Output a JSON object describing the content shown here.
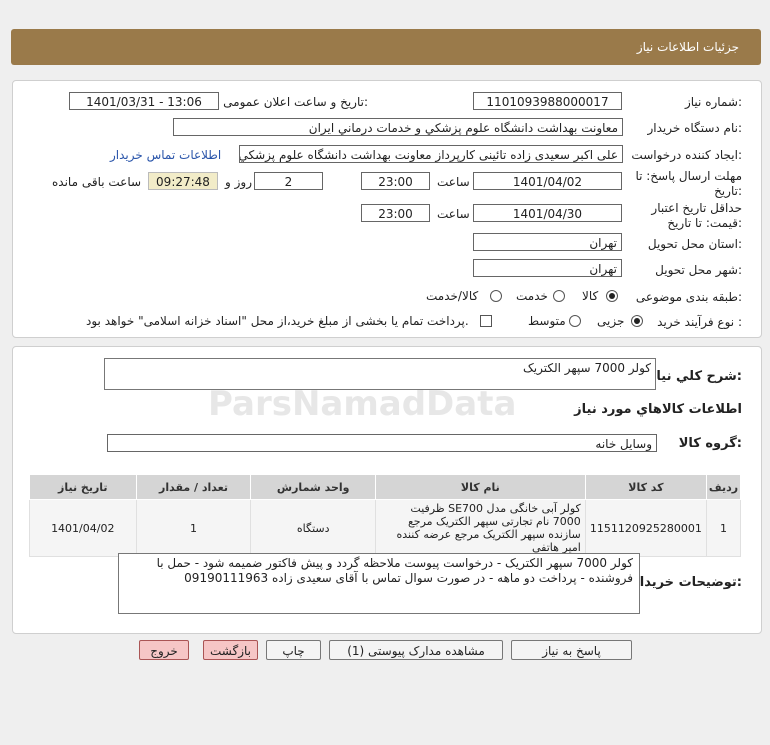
{
  "header": {
    "title": "جزئیات اطلاعات نیاز"
  },
  "form": {
    "need_number_label": "شماره نیاز:",
    "need_number": "1101093988000017",
    "announce_label": "تاریخ و ساعت اعلان عمومی:",
    "announce_value": "1401/03/31 - 13:06",
    "buyer_org_label": "نام دستگاه خریدار:",
    "buyer_org": "معاونت بهداشت دانشگاه علوم پزشکي و خدمات درماني ایران",
    "creator_label": "ایجاد کننده درخواست:",
    "creator": "علی اکبر سعیدی زاده تائینی کارپرداز معاونت بهداشت دانشگاه علوم پزشکي و",
    "contact_link": "اطلاعات تماس خریدار",
    "deadline_label_1": "مهلت ارسال پاسخ: تا",
    "deadline_label_2": "تاریخ:",
    "deadline_date": "1401/04/02",
    "time_label": "ساعت",
    "deadline_time": "23:00",
    "days_value": "2",
    "days_label": "روز و",
    "remaining_time": "09:27:48",
    "remaining_label": "ساعت باقی مانده",
    "validity_label_1": "حداقل تاریخ اعتبار",
    "validity_label_2": "قیمت: تا تاریخ:",
    "validity_date": "1401/04/30",
    "validity_time": "23:00",
    "province_label": "استان محل تحویل:",
    "province": "تهران",
    "city_label": "شهر محل تحویل:",
    "city": "تهران",
    "category_label": "طبقه بندی موضوعی:",
    "category_options": [
      "کالا",
      "خدمت",
      "کالا/خدمت"
    ],
    "process_label": "نوع فرآیند خرید :",
    "process_options": [
      "جزیی",
      "متوسط"
    ],
    "payment_note": "پرداخت تمام یا بخشی از مبلغ خرید،از محل \"اسناد خزانه اسلامی\" خواهد بود."
  },
  "details": {
    "need_desc_label": "شرح کلي نياز:",
    "need_desc": "کولر 7000 سپهر الکتریک",
    "items_title": "اطلاعات کالاهاي مورد نياز",
    "group_label": "گروه کالا:",
    "group_value": "وسایل خانه",
    "table_headers": [
      "ردیف",
      "کد کالا",
      "نام کالا",
      "واحد شمارش",
      "تعداد / مقدار",
      "تاریخ نیاز"
    ],
    "rows": [
      {
        "row": "1",
        "code": "1151120925280001",
        "name": "کولر آبی خانگی مدل SE700 ظرفیت 7000 نام تجارتی سپهر الکتریک مرجع سازنده سپهر الکتریک مرجع عرضه کننده امیر هاتفی",
        "unit": "دستگاه",
        "qty": "1",
        "date": "1401/04/02"
      }
    ],
    "buyer_notes_label": "توضیحات خریدار:",
    "buyer_notes": "کولر 7000 سپهر الکتریک - درخواست پیوست ملاحظه گردد و پیش فاکتور ضمیمه شود - حمل با فروشنده - پرداخت دو ماهه - در صورت سوال تماس با آقای سعیدی زاده 09190111963"
  },
  "buttons": {
    "reply": "پاسخ به نیاز",
    "attachments": "مشاهده مدارک پیوستی (1)",
    "print": "چاپ",
    "back": "بازگشت",
    "exit": "خروج"
  }
}
